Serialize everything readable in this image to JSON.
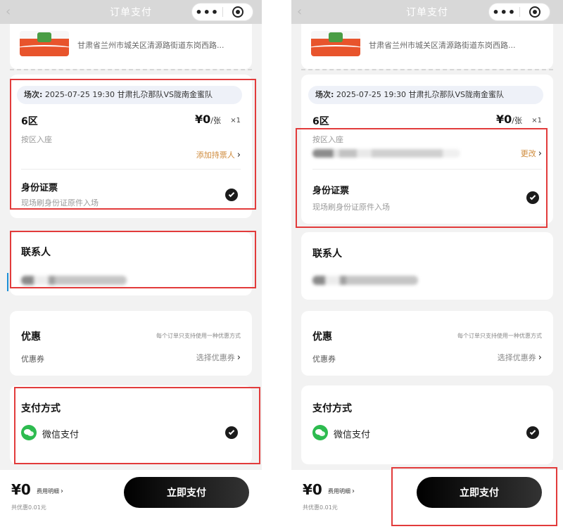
{
  "nav": {
    "title": "订单支付",
    "back_glyph": "‹",
    "more_glyph": "•••"
  },
  "venue": {
    "address": "甘肃省兰州市城关区清源路街道东岗西路..."
  },
  "ticket": {
    "session_label": "场次:",
    "session_text": "2025-07-25 19:30 甘肃扎尕那队VS陇南金蜜队",
    "zone": "6区",
    "price": "¥0",
    "price_unit": "/张",
    "quantity": "×1",
    "seat_type": "按区入座",
    "add_holder_link": "添加持票人",
    "change_link": "更改",
    "id_title": "身份证票",
    "id_sub": "现场刷身份证原件入场"
  },
  "contact": {
    "title": "联系人"
  },
  "promo": {
    "title": "优惠",
    "note": "每个订单只支持使用一种优惠方式",
    "coupon_label": "优惠券",
    "coupon_link": "选择优惠券"
  },
  "payment": {
    "title": "支付方式",
    "method": "微信支付"
  },
  "footer": {
    "total": "¥0",
    "fee_detail": "费用明细",
    "discount": "共优惠0.01元",
    "pay_button": "立即支付"
  },
  "colors": {
    "highlight": "#e23b3b",
    "wechat": "#2dbb4f",
    "link_orange": "#cf8a3a",
    "pay_button": "#111111"
  },
  "icons": [
    "chevron-right-icon",
    "check-circle-icon",
    "wechat-pay-icon",
    "more-dots-icon",
    "target-icon"
  ]
}
